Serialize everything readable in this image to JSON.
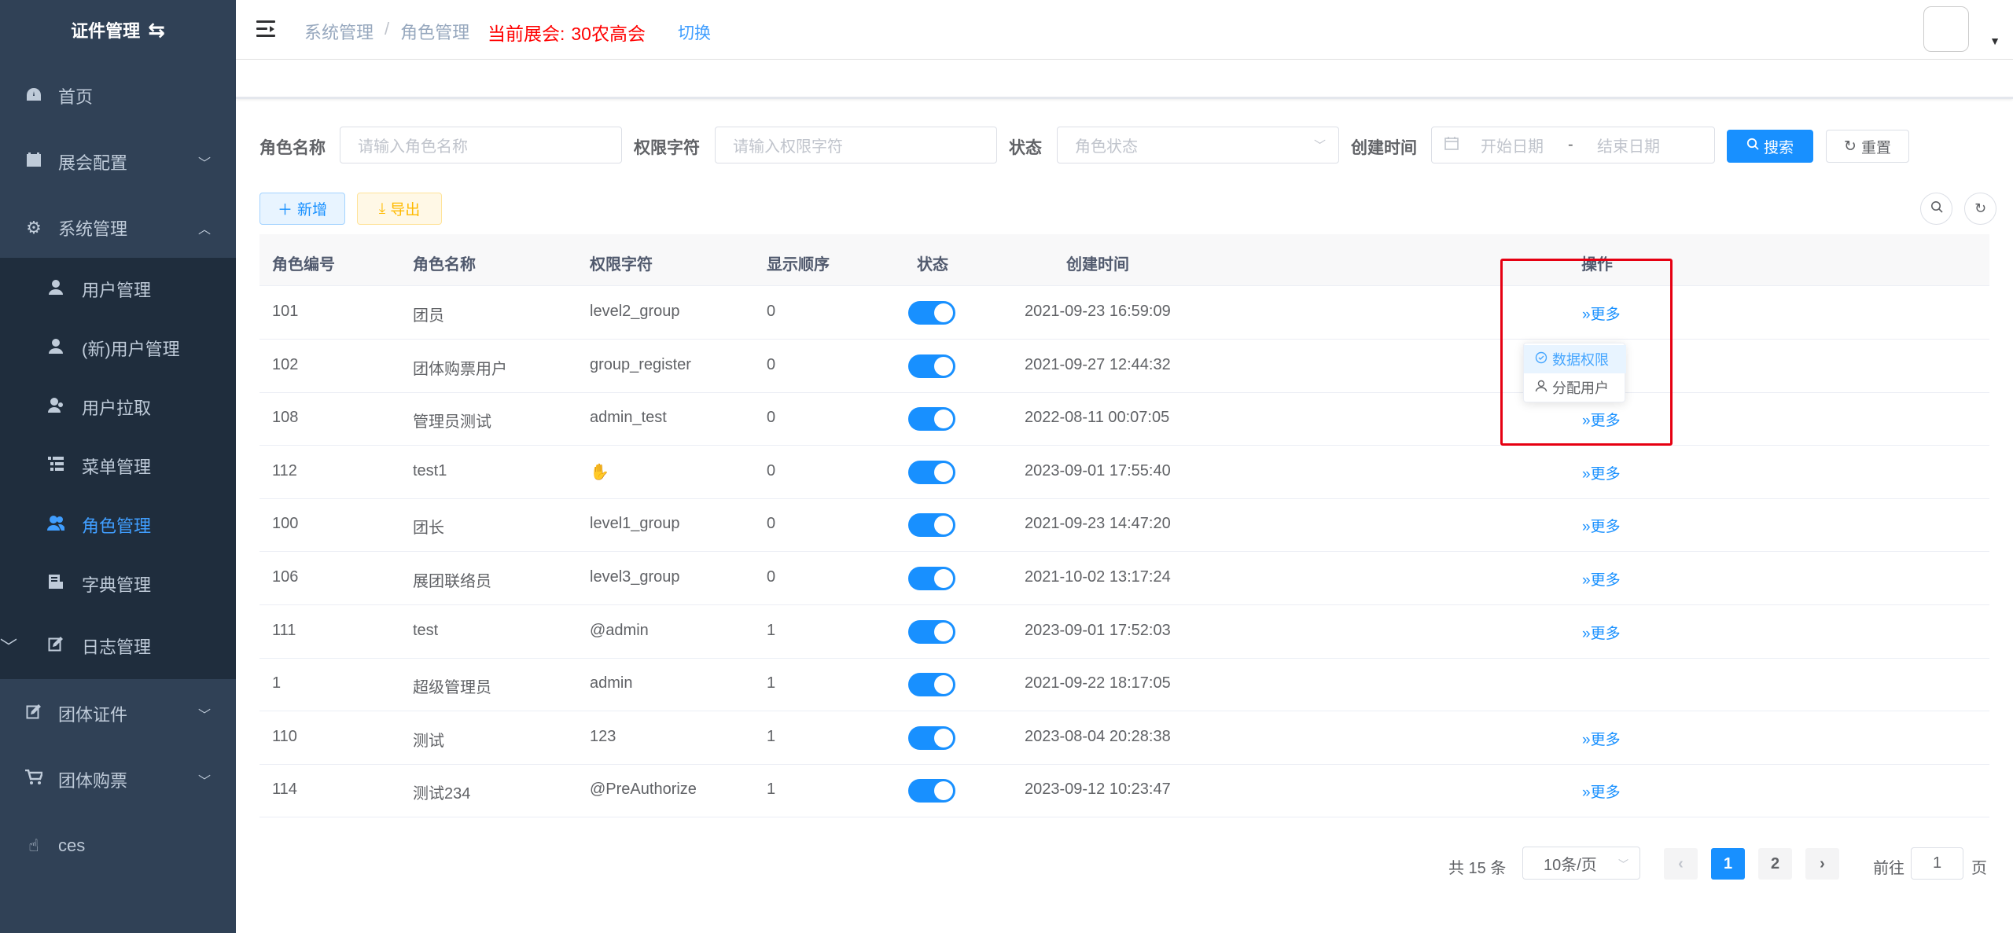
{
  "app": {
    "logo_text": "证件管理",
    "logo_icon": "swap-icon",
    "accent_color": "#1890ff",
    "sidebar_bg": "#304156"
  },
  "sidebar": {
    "items": [
      {
        "label": "首页",
        "icon": "dashboard-icon"
      },
      {
        "label": "展会配置",
        "icon": "calendar-icon"
      },
      {
        "label": "系统管理",
        "icon": "gear-icon"
      },
      {
        "label": "团体证件",
        "icon": "edit-icon"
      },
      {
        "label": "团体购票",
        "icon": "cart-icon"
      },
      {
        "label": "ces",
        "icon": "hand-icon"
      }
    ],
    "submenu": [
      {
        "label": "用户管理",
        "icon": "user-icon"
      },
      {
        "label": "(新)用户管理",
        "icon": "user-icon"
      },
      {
        "label": "用户拉取",
        "icon": "user-pull-icon"
      },
      {
        "label": "菜单管理",
        "icon": "tree-table-icon"
      },
      {
        "label": "角色管理",
        "icon": "peoples-icon"
      },
      {
        "label": "字典管理",
        "icon": "dict-icon"
      },
      {
        "label": "日志管理",
        "icon": "log-icon"
      }
    ]
  },
  "header": {
    "breadcrumb": [
      "系统管理",
      "角色管理"
    ],
    "breadcrumb_sep": "/",
    "current_expo_label": "当前展会:",
    "current_expo_value": "30农高会",
    "switch_label": "切换"
  },
  "search": {
    "role_name_label": "角色名称",
    "role_name_placeholder": "请输入角色名称",
    "perm_label": "权限字符",
    "perm_placeholder": "请输入权限字符",
    "status_label": "状态",
    "status_placeholder": "角色状态",
    "created_label": "创建时间",
    "start_placeholder": "开始日期",
    "date_sep": "-",
    "end_placeholder": "结束日期",
    "search_btn": "搜索",
    "reset_btn": "重置"
  },
  "toolbar": {
    "add_btn": "新增",
    "export_btn": "导出"
  },
  "table": {
    "columns": [
      "角色编号",
      "角色名称",
      "权限字符",
      "显示顺序",
      "状态",
      "创建时间",
      "操作"
    ],
    "more_label": "更多",
    "rows": [
      {
        "id": "101",
        "name": "团员",
        "perm": "level2_group",
        "order": "0",
        "enabled": true,
        "created": "2021-09-23 16:59:09",
        "more": true
      },
      {
        "id": "102",
        "name": "团体购票用户",
        "perm": "group_register",
        "order": "0",
        "enabled": true,
        "created": "2021-09-27 12:44:32",
        "more": false
      },
      {
        "id": "108",
        "name": "管理员测试",
        "perm": "admin_test",
        "order": "0",
        "enabled": true,
        "created": "2022-08-11 00:07:05",
        "more": true
      },
      {
        "id": "112",
        "name": "test1",
        "perm": "✋",
        "order": "0",
        "enabled": true,
        "created": "2023-09-01 17:55:40",
        "more": true
      },
      {
        "id": "100",
        "name": "团长",
        "perm": "level1_group",
        "order": "0",
        "enabled": true,
        "created": "2021-09-23 14:47:20",
        "more": true
      },
      {
        "id": "106",
        "name": "展团联络员",
        "perm": "level3_group",
        "order": "0",
        "enabled": true,
        "created": "2021-10-02 13:17:24",
        "more": true
      },
      {
        "id": "111",
        "name": "test",
        "perm": "@admin",
        "order": "1",
        "enabled": true,
        "created": "2023-09-01 17:52:03",
        "more": true
      },
      {
        "id": "1",
        "name": "超级管理员",
        "perm": "admin",
        "order": "1",
        "enabled": true,
        "created": "2021-09-22 18:17:05",
        "more": false
      },
      {
        "id": "110",
        "name": "测试",
        "perm": "123",
        "order": "1",
        "enabled": true,
        "created": "2023-08-04 20:28:38",
        "more": true
      },
      {
        "id": "114",
        "name": "测试234",
        "perm": "@PreAuthorize",
        "order": "1",
        "enabled": true,
        "created": "2023-09-12 10:23:47",
        "more": true
      }
    ]
  },
  "dropdown": {
    "items": [
      {
        "label": "数据权限",
        "icon": "circle-check-icon"
      },
      {
        "label": "分配用户",
        "icon": "user-icon"
      }
    ]
  },
  "pagination": {
    "total_text": "共 15 条",
    "page_size": "10条/页",
    "pages": [
      "1",
      "2"
    ],
    "current_page": "1",
    "goto_prefix": "前往",
    "goto_value": "1",
    "goto_suffix": "页"
  }
}
